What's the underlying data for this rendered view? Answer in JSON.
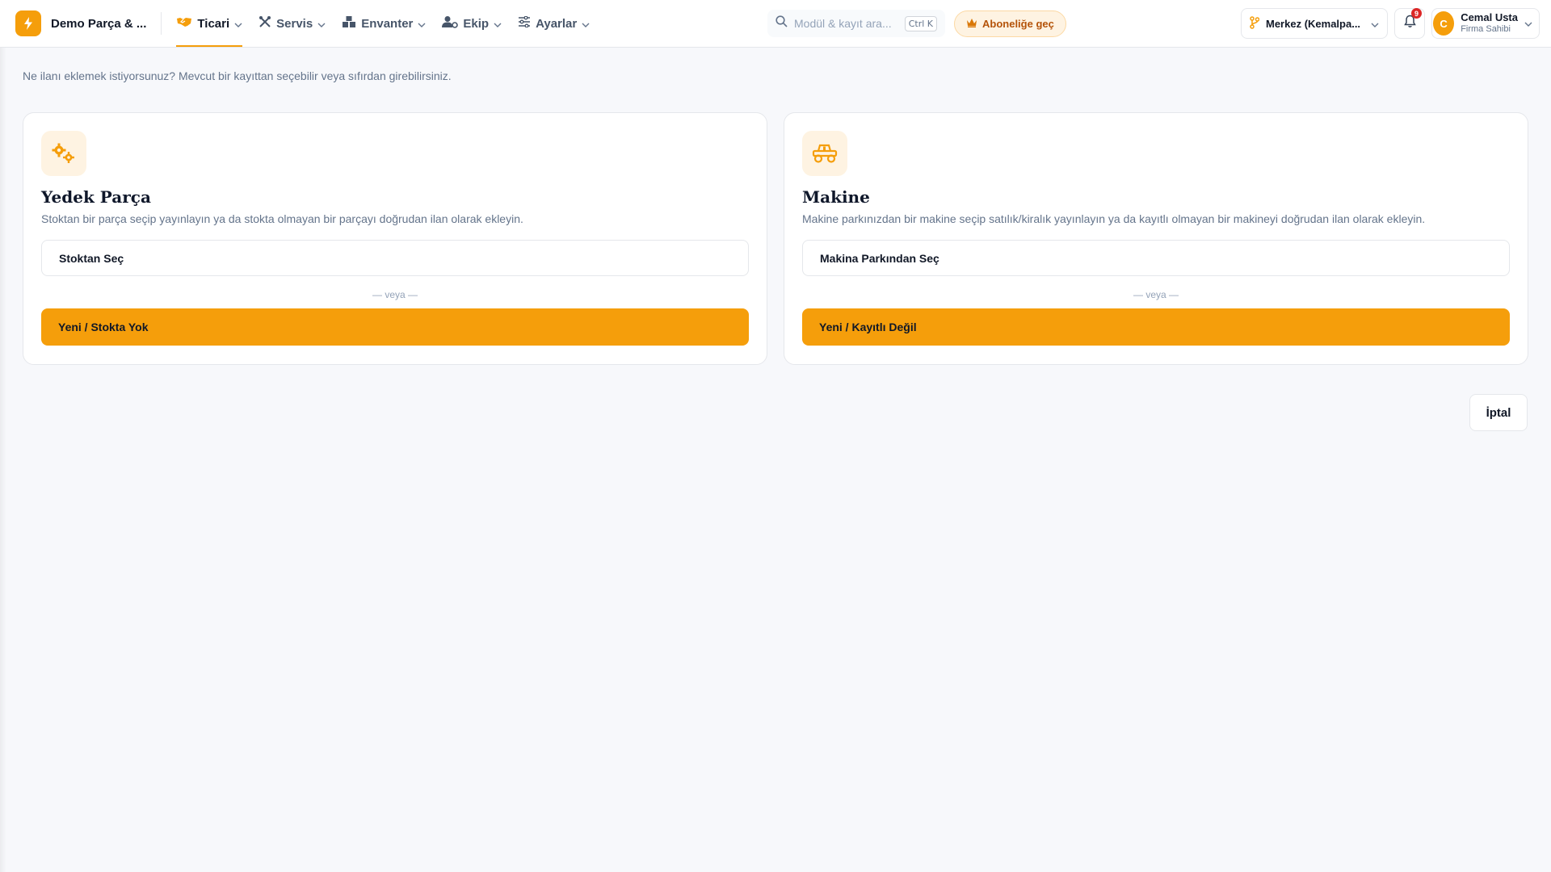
{
  "header": {
    "brand_name": "Demo Parça & ...",
    "nav": [
      {
        "label": "Ticari",
        "icon": "handshake-icon",
        "active": true
      },
      {
        "label": "Servis",
        "icon": "tools-icon"
      },
      {
        "label": "Envanter",
        "icon": "boxes-icon"
      },
      {
        "label": "Ekip",
        "icon": "user-gear-icon"
      },
      {
        "label": "Ayarlar",
        "icon": "sliders-icon"
      }
    ],
    "search_placeholder": "Modül & kayıt ara...",
    "search_shortcut": "Ctrl K",
    "subscribe_label": "Aboneliğe geç",
    "branch_label": "Merkez (Kemalpa...",
    "notification_count": "9",
    "user": {
      "initial": "C",
      "name": "Cemal Usta",
      "role": "Firma Sahibi"
    }
  },
  "main": {
    "intro": "Ne ilanı eklemek istiyorsunuz? Mevcut bir kayıttan seçebilir veya sıfırdan girebilirsiniz.",
    "cards": [
      {
        "icon": "gears-icon",
        "title": "Yedek Parça",
        "description": "Stoktan bir parça seçip yayınlayın ya da stokta olmayan bir parçayı doğrudan ilan olarak ekleyin.",
        "select_label": "Stoktan Seç",
        "or_label": "— veya —",
        "new_label": "Yeni / Stokta Yok"
      },
      {
        "icon": "truck-icon",
        "title": "Makine",
        "description": "Makine parkınızdan bir makine seçip satılık/kiralık yayınlayın ya da kayıtlı olmayan bir makineyi doğrudan ilan olarak ekleyin.",
        "select_label": "Makina Parkından Seç",
        "or_label": "— veya —",
        "new_label": "Yeni / Kayıtlı Değil"
      }
    ],
    "cancel_label": "İptal"
  },
  "colors": {
    "accent": "#f59e0b",
    "accent_soft": "#fef3e2",
    "badge": "#dc2626"
  }
}
